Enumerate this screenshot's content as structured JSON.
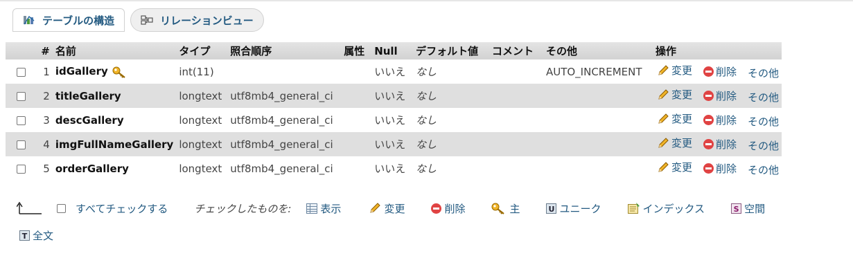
{
  "tabs": [
    {
      "label": "テーブルの構造",
      "icon": "table-structure-icon",
      "active": true
    },
    {
      "label": "リレーションビュー",
      "icon": "relation-view-icon",
      "active": false
    }
  ],
  "table": {
    "headers": [
      "#",
      "名前",
      "タイプ",
      "照合順序",
      "属性",
      "Null",
      "デフォルト値",
      "コメント",
      "その他",
      "操作"
    ],
    "rows": [
      {
        "num": "1",
        "name": "idGallery",
        "primary_key": true,
        "type": "int(11)",
        "collation": "",
        "attributes": "",
        "null": "いいえ",
        "default": "なし",
        "comment": "",
        "extra": "AUTO_INCREMENT"
      },
      {
        "num": "2",
        "name": "titleGallery",
        "primary_key": false,
        "type": "longtext",
        "collation": "utf8mb4_general_ci",
        "attributes": "",
        "null": "いいえ",
        "default": "なし",
        "comment": "",
        "extra": ""
      },
      {
        "num": "3",
        "name": "descGallery",
        "primary_key": false,
        "type": "longtext",
        "collation": "utf8mb4_general_ci",
        "attributes": "",
        "null": "いいえ",
        "default": "なし",
        "comment": "",
        "extra": ""
      },
      {
        "num": "4",
        "name": "imgFullNameGallery",
        "primary_key": false,
        "type": "longtext",
        "collation": "utf8mb4_general_ci",
        "attributes": "",
        "null": "いいえ",
        "default": "なし",
        "comment": "",
        "extra": ""
      },
      {
        "num": "5",
        "name": "orderGallery",
        "primary_key": false,
        "type": "longtext",
        "collation": "utf8mb4_general_ci",
        "attributes": "",
        "null": "いいえ",
        "default": "なし",
        "comment": "",
        "extra": ""
      }
    ],
    "row_actions": {
      "change": "変更",
      "drop": "削除",
      "more": "その他"
    }
  },
  "bulk": {
    "check_all": "すべてチェックする",
    "with_selected": "チェックしたものを:",
    "actions": [
      {
        "label": "表示",
        "icon": "browse-icon"
      },
      {
        "label": "変更",
        "icon": "pencil-icon"
      },
      {
        "label": "削除",
        "icon": "delete-icon"
      },
      {
        "label": "主",
        "icon": "primary-key-icon"
      },
      {
        "label": "ユニーク",
        "icon": "unique-icon",
        "glyph": "U"
      },
      {
        "label": "インデックス",
        "icon": "index-icon"
      },
      {
        "label": "空間",
        "icon": "spatial-icon",
        "glyph": "S"
      },
      {
        "label": "全文",
        "icon": "fulltext-icon",
        "glyph": "T"
      }
    ]
  },
  "colors": {
    "link": "#235a81",
    "header_bg": "#d8d8d8",
    "even_row_bg": "#dfdfdf",
    "delete": "#e04343",
    "key": "#e0a020"
  }
}
